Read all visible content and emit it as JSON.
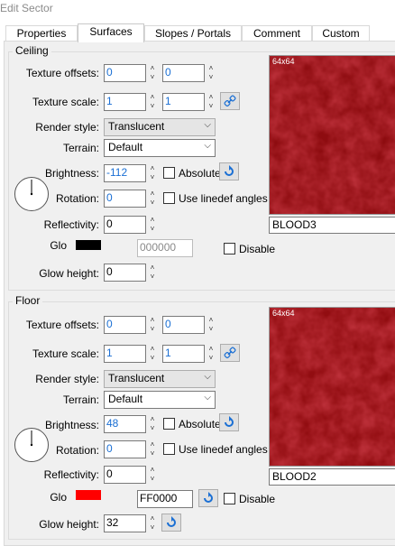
{
  "window": {
    "title": "Edit Sector"
  },
  "tabs": [
    {
      "label": "Properties"
    },
    {
      "label": "Surfaces"
    },
    {
      "label": "Slopes / Portals"
    },
    {
      "label": "Comment"
    },
    {
      "label": "Custom"
    }
  ],
  "labels": {
    "texture_offsets": "Texture offsets:",
    "texture_scale": "Texture scale:",
    "render_style": "Render style:",
    "terrain": "Terrain:",
    "brightness": "Brightness:",
    "rotation": "Rotation:",
    "reflectivity": "Reflectivity:",
    "glow": "Glo",
    "glow_height": "Glow height:",
    "absolute": "Absolute",
    "use_linedef_angles": "Use linedef angles",
    "disable": "Disable"
  },
  "icons": {
    "link": "link-icon",
    "reset": "reset-arrow-icon",
    "dial": "rotation-dial-icon"
  },
  "ceiling": {
    "title": "Ceiling",
    "offset_x": "0",
    "offset_y": "0",
    "scale_x": "1",
    "scale_y": "1",
    "render_style": "Translucent",
    "terrain": "Default",
    "brightness": "-112",
    "rotation": "0",
    "reflectivity": "0",
    "glow_color": "000000",
    "glow_swatch": "#000000",
    "glow_height": "0",
    "texture_size": "64x64",
    "texture_name": "BLOOD3"
  },
  "floor": {
    "title": "Floor",
    "offset_x": "0",
    "offset_y": "0",
    "scale_x": "1",
    "scale_y": "1",
    "render_style": "Translucent",
    "terrain": "Default",
    "brightness": "48",
    "rotation": "0",
    "reflectivity": "0",
    "glow_color": "FF0000",
    "glow_swatch": "#ff0000",
    "glow_height": "32",
    "texture_size": "64x64",
    "texture_name": "BLOOD2"
  },
  "colors": {
    "value_blue": "#1a6fd4",
    "texture_red": "#9b0f12"
  }
}
